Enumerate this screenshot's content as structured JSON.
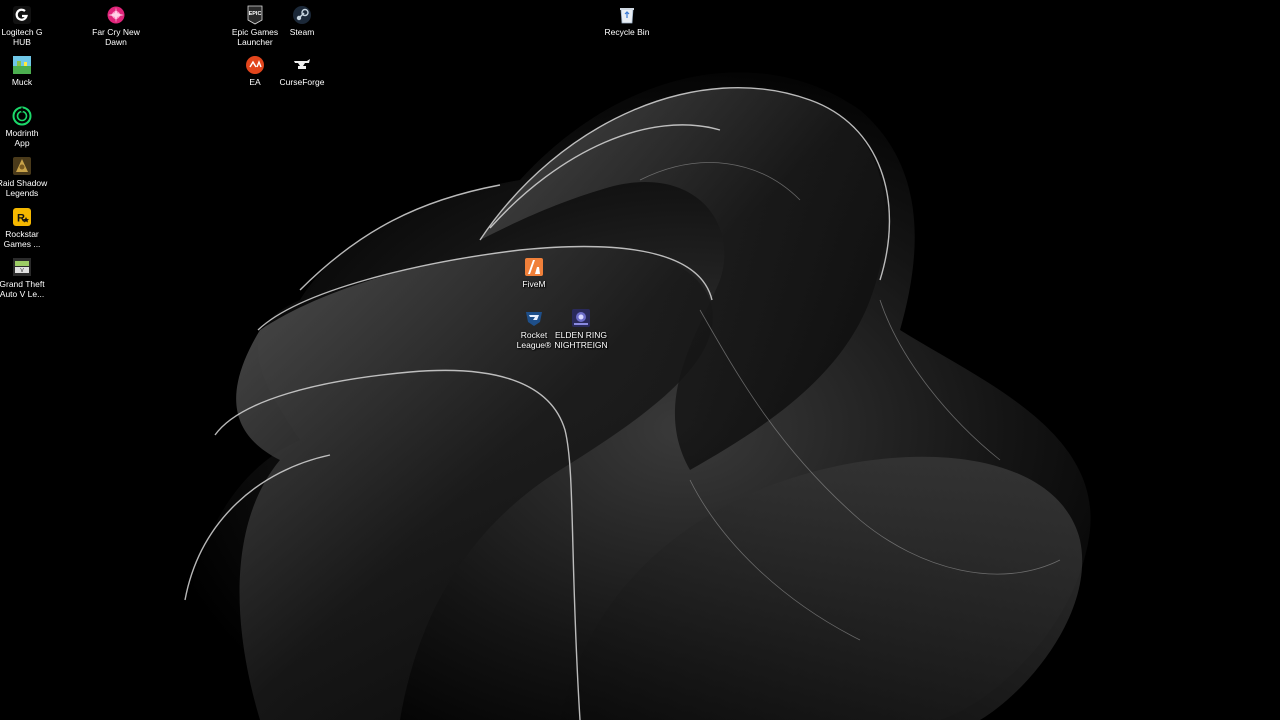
{
  "desktop": {
    "icons": [
      {
        "label": "Logitech G\nHUB",
        "icon": "logitech-g-icon"
      },
      {
        "label": "Far Cry New\nDawn",
        "icon": "far-cry-icon"
      },
      {
        "label": "Epic Games\nLauncher",
        "icon": "epic-games-icon",
        "badge": "EPIC"
      },
      {
        "label": "Steam",
        "icon": "steam-icon"
      },
      {
        "label": "Recycle Bin",
        "icon": "recycle-bin-icon"
      },
      {
        "label": "Muck",
        "icon": "muck-icon"
      },
      {
        "label": "EA",
        "icon": "ea-icon"
      },
      {
        "label": "CurseForge",
        "icon": "curseforge-icon"
      },
      {
        "label": "Modrinth\nApp",
        "icon": "modrinth-icon"
      },
      {
        "label": "Raid Shadow\nLegends",
        "icon": "raid-shadow-legends-icon"
      },
      {
        "label": "Rockstar\nGames ...",
        "icon": "rockstar-games-icon",
        "badge": "R"
      },
      {
        "label": "Grand Theft\nAuto V Le...",
        "icon": "gta-v-icon"
      },
      {
        "label": "FiveM",
        "icon": "fivem-icon"
      },
      {
        "label": "Rocket\nLeague®",
        "icon": "rocket-league-icon"
      },
      {
        "label": "ELDEN RING\nNIGHTREIGN",
        "icon": "elden-ring-nightreign-icon"
      }
    ]
  },
  "colors": {
    "background": "#000000",
    "label": "#ffffff",
    "far_cry": "#e0247a",
    "ea": "#e2451c",
    "fivem": "#f0803a",
    "rockstar": "#f5b800",
    "modrinth": "#1bd96a",
    "steam": "#1b2838"
  }
}
